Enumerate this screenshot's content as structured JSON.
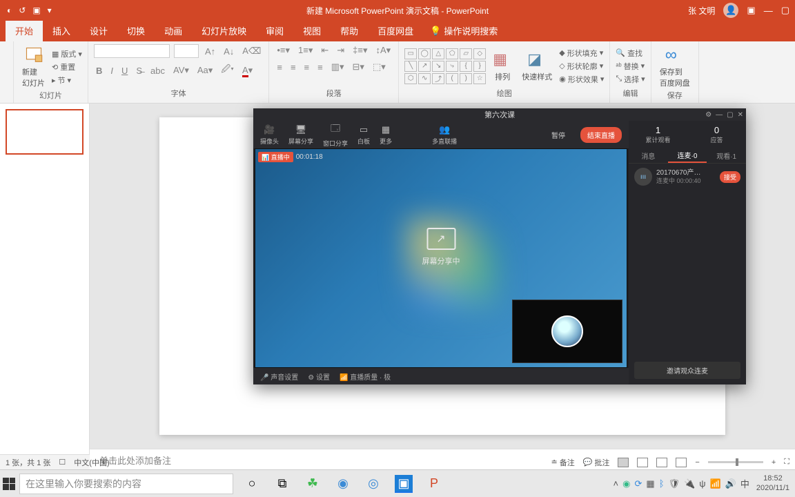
{
  "app": {
    "title": "新建 Microsoft PowerPoint 演示文稿 - PowerPoint",
    "user": "张 文明"
  },
  "ribbon": {
    "tabs": [
      "开始",
      "插入",
      "设计",
      "切换",
      "动画",
      "幻灯片放映",
      "审阅",
      "视图",
      "帮助",
      "百度网盘"
    ],
    "active_tab": "开始",
    "tell_me": "操作说明搜索",
    "groups": {
      "slides": {
        "label": "幻灯片",
        "new_slide": "新建\n幻灯片",
        "layout": "版式",
        "reset": "重置",
        "section": "节"
      },
      "font": {
        "label": "字体"
      },
      "paragraph": {
        "label": "段落"
      },
      "drawing": {
        "label": "绘图",
        "arrange": "排列",
        "quickstyle": "快速样式",
        "fill": "形状填充",
        "outline": "形状轮廓",
        "effects": "形状效果"
      },
      "editing": {
        "label": "编辑",
        "find": "查找",
        "replace": "替换",
        "select": "选择"
      },
      "save": {
        "label": "保存",
        "btn": "保存到\n百度网盘"
      }
    }
  },
  "notes_placeholder": "单击此处添加备注",
  "statusbar": {
    "slide_info": "1 张，共 1 张",
    "language": "中文(中国)",
    "notes_btn": "备注",
    "comments_btn": "批注"
  },
  "taskbar": {
    "search_placeholder": "在这里输入你要搜索的内容",
    "time": "18:52",
    "date": "2020/11/1",
    "ime": "中"
  },
  "overlay": {
    "title": "第六次课",
    "toolbar": {
      "camera": "摄像头",
      "screen": "屏幕分享",
      "window": "窗口分享",
      "whiteboard": "白板",
      "more": "更多",
      "multi": "多直联播",
      "pause": "暂停",
      "end": "结束直播"
    },
    "live_badge": "直播中",
    "timer": "00:01:18",
    "share_label": "屏幕分享中",
    "footer": {
      "audio": "声音设置",
      "settings": "设置",
      "quality_label": "直播质量",
      "quality_value": "极"
    },
    "stats": [
      {
        "num": "1",
        "label": "累计观看"
      },
      {
        "num": "0",
        "label": "应答"
      }
    ],
    "side_tabs": [
      "消息",
      "连麦·0",
      "观看·1"
    ],
    "active_side_tab": 1,
    "user": {
      "name": "20170670产…",
      "status": "连麦中 00:00:40",
      "btn": "接受"
    },
    "invite": "邀请观众连麦"
  }
}
